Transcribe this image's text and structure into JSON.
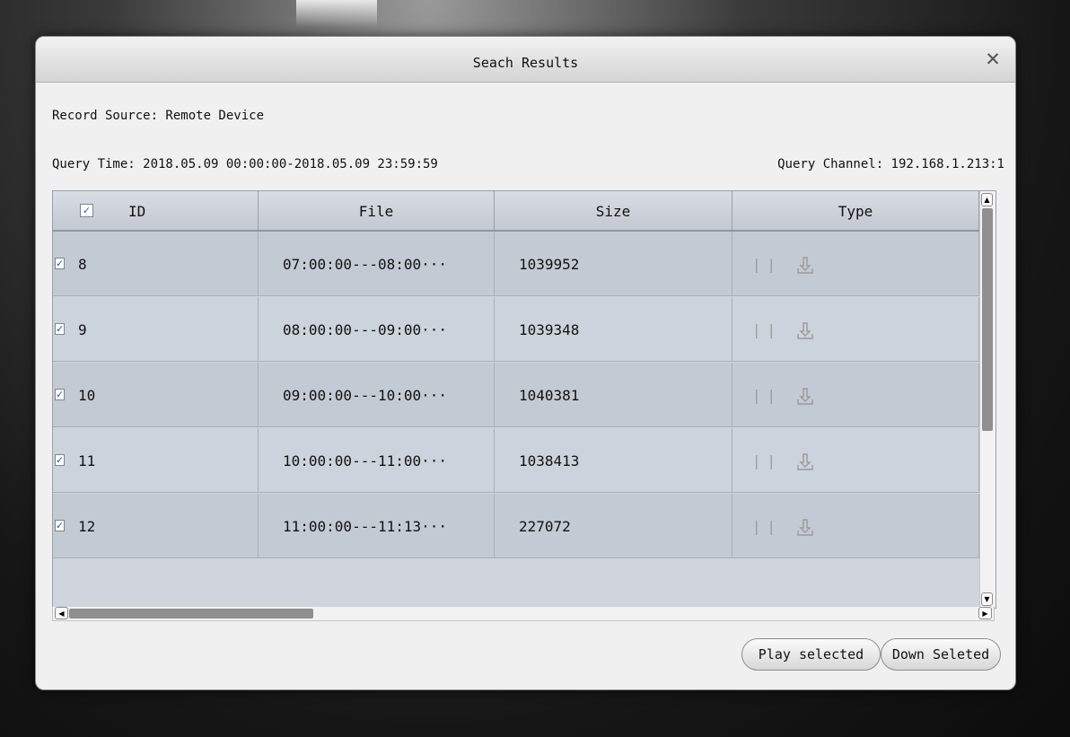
{
  "dialog": {
    "title": "Seach Results",
    "close_symbol": "✕"
  },
  "info": {
    "record_source": "Record Source: Remote Device",
    "query_time": "Query Time: 2018.05.09 00:00:00-2018.05.09 23:59:59",
    "query_channel": "Query Channel: 192.168.1.213:1"
  },
  "table": {
    "headers": [
      "ID",
      "File",
      "Size",
      "Type"
    ],
    "header_checked": true,
    "rows": [
      {
        "checked": true,
        "id": "8",
        "file": "07:00:00---08:00···",
        "size": "1039952"
      },
      {
        "checked": true,
        "id": "9",
        "file": "08:00:00---09:00···",
        "size": "1039348"
      },
      {
        "checked": true,
        "id": "10",
        "file": "09:00:00---10:00···",
        "size": "1040381"
      },
      {
        "checked": true,
        "id": "11",
        "file": "10:00:00---11:00···",
        "size": "1038413"
      },
      {
        "checked": true,
        "id": "12",
        "file": "11:00:00---11:13···",
        "size": "227072"
      }
    ],
    "row_icons": [
      "pause-icon",
      "download-icon"
    ]
  },
  "buttons": {
    "play_selected": "Play selected",
    "down_selected": "Down Seleted"
  },
  "colors": {
    "checkmark": "#2a55b8",
    "row_alt_a": "#c4cad4",
    "row_alt_b": "#cdd3dc"
  }
}
